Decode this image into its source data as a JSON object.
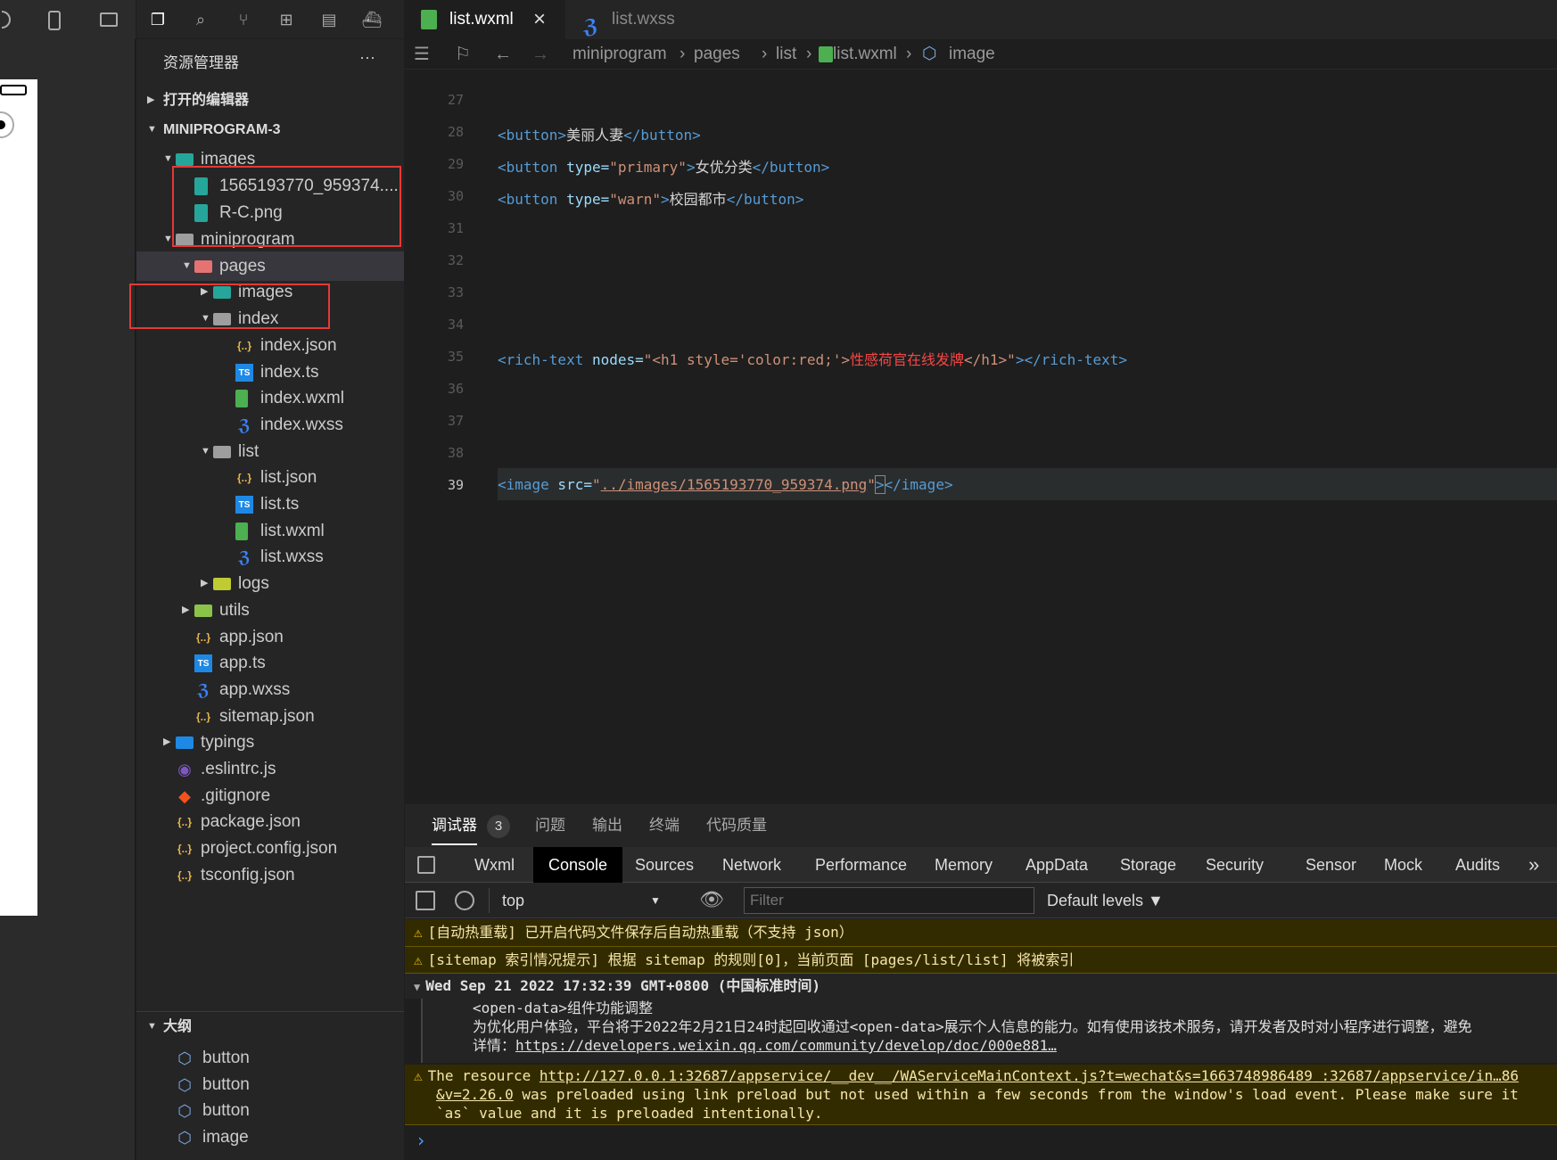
{
  "explorer": {
    "title": "资源管理器",
    "more": "···",
    "open_editors": "打开的编辑器",
    "project": "MINIPROGRAM-3",
    "outline_title": "大纲",
    "tree": [
      {
        "label": "images",
        "depth": 1
      },
      {
        "label": "1565193770_959374....",
        "depth": 2
      },
      {
        "label": "R-C.png",
        "depth": 2
      },
      {
        "label": "miniprogram",
        "depth": 1
      },
      {
        "label": "pages",
        "depth": 2
      },
      {
        "label": "images",
        "depth": 3
      },
      {
        "label": "index",
        "depth": 3
      },
      {
        "label": "index.json",
        "depth": 4
      },
      {
        "label": "index.ts",
        "depth": 4
      },
      {
        "label": "index.wxml",
        "depth": 4
      },
      {
        "label": "index.wxss",
        "depth": 4
      },
      {
        "label": "list",
        "depth": 3
      },
      {
        "label": "list.json",
        "depth": 4
      },
      {
        "label": "list.ts",
        "depth": 4
      },
      {
        "label": "list.wxml",
        "depth": 4
      },
      {
        "label": "list.wxss",
        "depth": 4
      },
      {
        "label": "logs",
        "depth": 3
      },
      {
        "label": "utils",
        "depth": 2
      },
      {
        "label": "app.json",
        "depth": 2
      },
      {
        "label": "app.ts",
        "depth": 2
      },
      {
        "label": "app.wxss",
        "depth": 2
      },
      {
        "label": "sitemap.json",
        "depth": 2
      },
      {
        "label": "typings",
        "depth": 1
      },
      {
        "label": ".eslintrc.js",
        "depth": 1
      },
      {
        "label": ".gitignore",
        "depth": 1
      },
      {
        "label": "package.json",
        "depth": 1
      },
      {
        "label": "project.config.json",
        "depth": 1
      },
      {
        "label": "tsconfig.json",
        "depth": 1
      }
    ],
    "outline": [
      "button",
      "button",
      "button",
      "image"
    ]
  },
  "editor": {
    "tabs": [
      "list.wxml",
      "list.wxss"
    ],
    "tab_close": "×",
    "breadcrumb": [
      "miniprogram",
      "pages",
      "list",
      "list.wxml",
      "image"
    ],
    "line_numbers": [
      "27",
      "28",
      "29",
      "30",
      "31",
      "32",
      "33",
      "34",
      "35",
      "36",
      "37",
      "38",
      "39"
    ],
    "code": {
      "l28_tag_open": "<button>",
      "l28_text": "美丽人妻",
      "l28_tag_close": "</button>",
      "l29_tag": "<button",
      "l29_attr": " type=",
      "l29_val": "\"primary\"",
      "l29_gt": ">",
      "l29_text": "女优分类",
      "l29_close": "</button>",
      "l30_tag": "<button",
      "l30_attr": " type=",
      "l30_val": "\"warn\"",
      "l30_gt": ">",
      "l30_text": "校园都市",
      "l30_close": "</button>",
      "l35_tag": "<rich-text",
      "l35_attr": " nodes=",
      "l35_q1": "\"",
      "l35_h1": "<h1",
      "l35_style": " style=",
      "l35_sval": "'color:red;'",
      "l35_gt": ">",
      "l35_text": "性感荷官在线发牌",
      "l35_h1c": "</h1>",
      "l35_q2": "\"",
      "l35_end": "></rich-text>",
      "l39_tag": "<image",
      "l39_attr": " src=",
      "l39_q1": "\"",
      "l39_path": "../images/1565193770_959374.png",
      "l39_q2": "\"",
      "l39_gt": ">",
      "l39_close": "</image>"
    }
  },
  "devtools": {
    "top_tabs": [
      "调试器",
      "问题",
      "输出",
      "终端",
      "代码质量"
    ],
    "badge": "3",
    "tabs": [
      "Wxml",
      "Console",
      "Sources",
      "Network",
      "Performance",
      "Memory",
      "AppData",
      "Storage",
      "Security",
      "Sensor",
      "Mock",
      "Audits"
    ],
    "more": "»",
    "context": "top",
    "filter_placeholder": "Filter",
    "levels": "Default levels ▼",
    "messages": {
      "w1": "[自动热重载] 已开启代码文件保存后自动热重载（不支持 json）",
      "w2": "[sitemap 索引情况提示] 根据 sitemap 的规则[0]，当前页面 [pages/list/list] 将被索引",
      "group": "Wed Sep 21 2022 17:32:39 GMT+0800 (中国标准时间)",
      "g1": "<open-data>组件功能调整",
      "g2": "为优化用户体验，平台将于2022年2月21日24时起回收通过<open-data>展示个人信息的能力。如有使用该技术服务，请开发者及时对小程序进行调整，避免",
      "g3_label": "详情：",
      "g3_link": "https://developers.weixin.qq.com/community/develop/doc/000e881…",
      "w3_a": "The resource ",
      "w3_link": "http://127.0.0.1:32687/appservice/__dev__/WAServiceMainContext.js?t=wechat&s=1663748986489",
      "w3_b": " :32687/appservice/in…86",
      "w3_link2": "&v=2.26.0",
      "w3_c": " was preloaded using link preload but not used within a few seconds from the window's load event. Please make sure it",
      "w3_d": "`as` value and it is preloaded intentionally.",
      "prompt": "›"
    }
  }
}
